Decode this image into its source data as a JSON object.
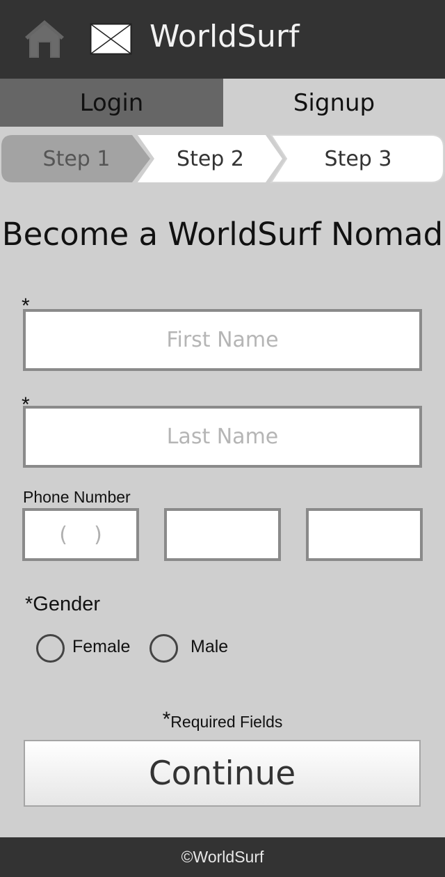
{
  "header": {
    "title": "WorldSurf",
    "home_icon": "home-icon",
    "logo_icon": "image-placeholder-icon",
    "bg_color": "#333333"
  },
  "tabs": [
    {
      "label": "Login",
      "active": false
    },
    {
      "label": "Signup",
      "active": true
    }
  ],
  "steps": [
    {
      "label": "Step 1",
      "current": true
    },
    {
      "label": "Step 2",
      "current": false
    },
    {
      "label": "Step 3",
      "current": false
    }
  ],
  "form": {
    "title": "Become a WorldSurf Nomad",
    "required_marker": "*",
    "first_name": {
      "placeholder": "First Name",
      "value": ""
    },
    "last_name": {
      "placeholder": "Last Name",
      "value": ""
    },
    "phone": {
      "label": "Phone Number",
      "area_placeholder": "(    )",
      "prefix_placeholder": "",
      "line_placeholder": ""
    },
    "gender": {
      "label": "*Gender",
      "options": [
        "Female",
        "Male"
      ],
      "selected": null
    },
    "required_note": {
      "star": "*",
      "text": "Required Fields"
    },
    "continue_label": "Continue"
  },
  "footer": {
    "text": "©WorldSurf"
  }
}
